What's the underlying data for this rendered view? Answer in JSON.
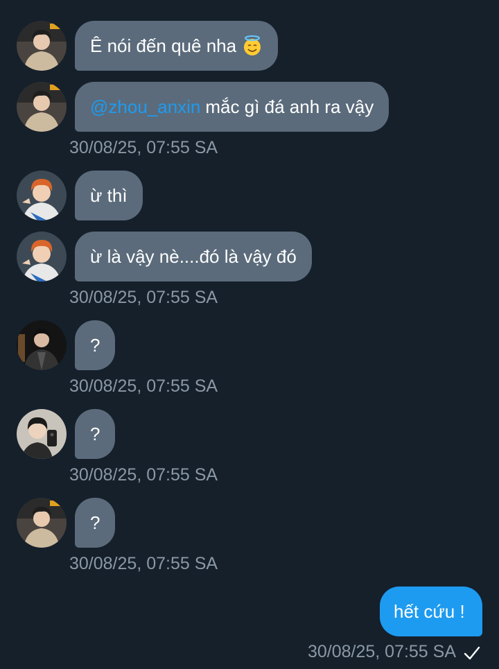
{
  "messages": [
    {
      "sender_avatar": "avatar-boy-beige-jacket",
      "mention": "",
      "text": "Ê nói đến quê nha",
      "emoji": "smiling-face-with-halo-icon"
    },
    {
      "sender_avatar": "avatar-boy-beige-jacket",
      "mention": "@zhou_anxin",
      "text": "mắc gì đá anh ra vậy"
    },
    {
      "sender_avatar": "avatar-orange-hair",
      "mention": "",
      "text": "ừ thì"
    },
    {
      "sender_avatar": "avatar-orange-hair",
      "mention": "",
      "text": "ừ là vậy nè....đó là vậy đó"
    },
    {
      "sender_avatar": "avatar-dark-jacket",
      "mention": "",
      "text": "?"
    },
    {
      "sender_avatar": "avatar-mirror-selfie",
      "mention": "",
      "text": "?"
    },
    {
      "sender_avatar": "avatar-boy-beige-jacket",
      "mention": "",
      "text": "?"
    }
  ],
  "timestamps": [
    "30/08/25, 07:55 SA",
    "30/08/25, 07:55 SA",
    "30/08/25, 07:55 SA",
    "30/08/25, 07:55 SA",
    "30/08/25, 07:55 SA"
  ],
  "outgoing": {
    "text": "hết cứu !",
    "timestamp": "30/08/25, 07:55 SA",
    "status_icon": "sent-check-icon"
  },
  "colors": {
    "background": "#15202b",
    "incoming_bubble": "#5b6b7b",
    "outgoing_bubble": "#1d9bf0",
    "mention": "#1d9bf0",
    "timestamp": "#8b98a5"
  }
}
